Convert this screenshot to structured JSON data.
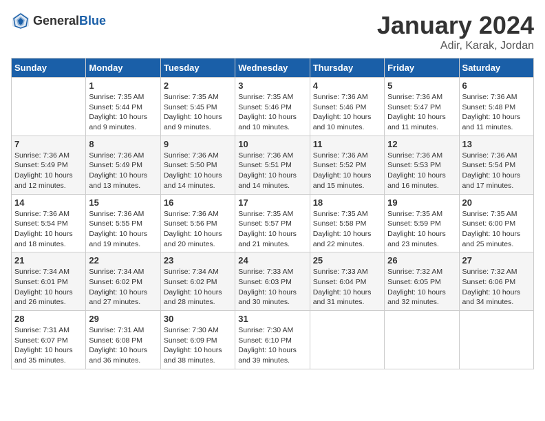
{
  "header": {
    "logo": {
      "text_general": "General",
      "text_blue": "Blue"
    },
    "month": "January 2024",
    "location": "Adir, Karak, Jordan"
  },
  "days_of_week": [
    "Sunday",
    "Monday",
    "Tuesday",
    "Wednesday",
    "Thursday",
    "Friday",
    "Saturday"
  ],
  "weeks": [
    [
      {
        "day": "",
        "info": ""
      },
      {
        "day": "1",
        "info": "Sunrise: 7:35 AM\nSunset: 5:44 PM\nDaylight: 10 hours\nand 9 minutes."
      },
      {
        "day": "2",
        "info": "Sunrise: 7:35 AM\nSunset: 5:45 PM\nDaylight: 10 hours\nand 9 minutes."
      },
      {
        "day": "3",
        "info": "Sunrise: 7:35 AM\nSunset: 5:46 PM\nDaylight: 10 hours\nand 10 minutes."
      },
      {
        "day": "4",
        "info": "Sunrise: 7:36 AM\nSunset: 5:46 PM\nDaylight: 10 hours\nand 10 minutes."
      },
      {
        "day": "5",
        "info": "Sunrise: 7:36 AM\nSunset: 5:47 PM\nDaylight: 10 hours\nand 11 minutes."
      },
      {
        "day": "6",
        "info": "Sunrise: 7:36 AM\nSunset: 5:48 PM\nDaylight: 10 hours\nand 11 minutes."
      }
    ],
    [
      {
        "day": "7",
        "info": "Sunrise: 7:36 AM\nSunset: 5:49 PM\nDaylight: 10 hours\nand 12 minutes."
      },
      {
        "day": "8",
        "info": "Sunrise: 7:36 AM\nSunset: 5:49 PM\nDaylight: 10 hours\nand 13 minutes."
      },
      {
        "day": "9",
        "info": "Sunrise: 7:36 AM\nSunset: 5:50 PM\nDaylight: 10 hours\nand 14 minutes."
      },
      {
        "day": "10",
        "info": "Sunrise: 7:36 AM\nSunset: 5:51 PM\nDaylight: 10 hours\nand 14 minutes."
      },
      {
        "day": "11",
        "info": "Sunrise: 7:36 AM\nSunset: 5:52 PM\nDaylight: 10 hours\nand 15 minutes."
      },
      {
        "day": "12",
        "info": "Sunrise: 7:36 AM\nSunset: 5:53 PM\nDaylight: 10 hours\nand 16 minutes."
      },
      {
        "day": "13",
        "info": "Sunrise: 7:36 AM\nSunset: 5:54 PM\nDaylight: 10 hours\nand 17 minutes."
      }
    ],
    [
      {
        "day": "14",
        "info": "Sunrise: 7:36 AM\nSunset: 5:54 PM\nDaylight: 10 hours\nand 18 minutes."
      },
      {
        "day": "15",
        "info": "Sunrise: 7:36 AM\nSunset: 5:55 PM\nDaylight: 10 hours\nand 19 minutes."
      },
      {
        "day": "16",
        "info": "Sunrise: 7:36 AM\nSunset: 5:56 PM\nDaylight: 10 hours\nand 20 minutes."
      },
      {
        "day": "17",
        "info": "Sunrise: 7:35 AM\nSunset: 5:57 PM\nDaylight: 10 hours\nand 21 minutes."
      },
      {
        "day": "18",
        "info": "Sunrise: 7:35 AM\nSunset: 5:58 PM\nDaylight: 10 hours\nand 22 minutes."
      },
      {
        "day": "19",
        "info": "Sunrise: 7:35 AM\nSunset: 5:59 PM\nDaylight: 10 hours\nand 23 minutes."
      },
      {
        "day": "20",
        "info": "Sunrise: 7:35 AM\nSunset: 6:00 PM\nDaylight: 10 hours\nand 25 minutes."
      }
    ],
    [
      {
        "day": "21",
        "info": "Sunrise: 7:34 AM\nSunset: 6:01 PM\nDaylight: 10 hours\nand 26 minutes."
      },
      {
        "day": "22",
        "info": "Sunrise: 7:34 AM\nSunset: 6:02 PM\nDaylight: 10 hours\nand 27 minutes."
      },
      {
        "day": "23",
        "info": "Sunrise: 7:34 AM\nSunset: 6:02 PM\nDaylight: 10 hours\nand 28 minutes."
      },
      {
        "day": "24",
        "info": "Sunrise: 7:33 AM\nSunset: 6:03 PM\nDaylight: 10 hours\nand 30 minutes."
      },
      {
        "day": "25",
        "info": "Sunrise: 7:33 AM\nSunset: 6:04 PM\nDaylight: 10 hours\nand 31 minutes."
      },
      {
        "day": "26",
        "info": "Sunrise: 7:32 AM\nSunset: 6:05 PM\nDaylight: 10 hours\nand 32 minutes."
      },
      {
        "day": "27",
        "info": "Sunrise: 7:32 AM\nSunset: 6:06 PM\nDaylight: 10 hours\nand 34 minutes."
      }
    ],
    [
      {
        "day": "28",
        "info": "Sunrise: 7:31 AM\nSunset: 6:07 PM\nDaylight: 10 hours\nand 35 minutes."
      },
      {
        "day": "29",
        "info": "Sunrise: 7:31 AM\nSunset: 6:08 PM\nDaylight: 10 hours\nand 36 minutes."
      },
      {
        "day": "30",
        "info": "Sunrise: 7:30 AM\nSunset: 6:09 PM\nDaylight: 10 hours\nand 38 minutes."
      },
      {
        "day": "31",
        "info": "Sunrise: 7:30 AM\nSunset: 6:10 PM\nDaylight: 10 hours\nand 39 minutes."
      },
      {
        "day": "",
        "info": ""
      },
      {
        "day": "",
        "info": ""
      },
      {
        "day": "",
        "info": ""
      }
    ]
  ]
}
